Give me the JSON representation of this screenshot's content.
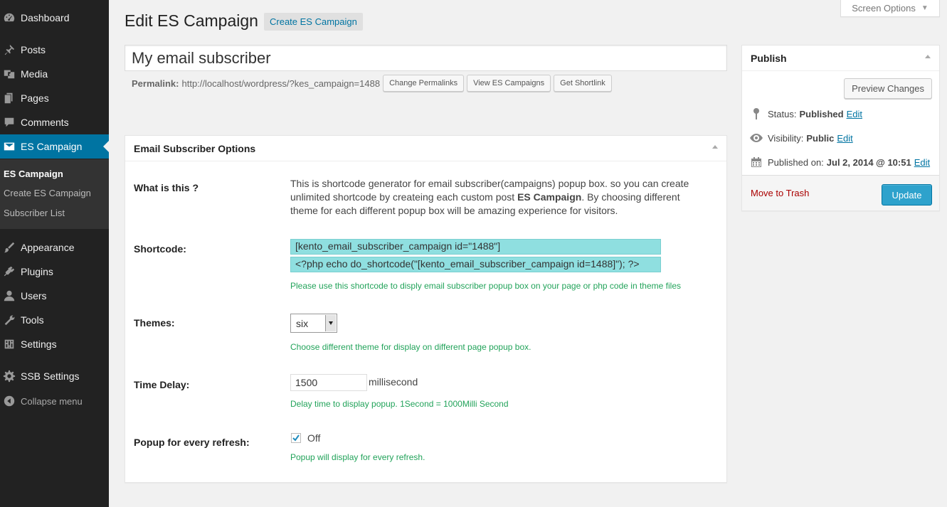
{
  "sidebar": {
    "items": [
      {
        "label": "Dashboard",
        "icon": "dashboard-icon"
      },
      {
        "label": "Posts",
        "icon": "pin-icon"
      },
      {
        "label": "Media",
        "icon": "media-icon"
      },
      {
        "label": "Pages",
        "icon": "pages-icon"
      },
      {
        "label": "Comments",
        "icon": "comment-icon"
      },
      {
        "label": "ES Campaign",
        "icon": "envelope-icon"
      },
      {
        "label": "Appearance",
        "icon": "brush-icon"
      },
      {
        "label": "Plugins",
        "icon": "plugin-icon"
      },
      {
        "label": "Users",
        "icon": "user-icon"
      },
      {
        "label": "Tools",
        "icon": "wrench-icon"
      },
      {
        "label": "Settings",
        "icon": "settings-icon"
      },
      {
        "label": "SSB Settings",
        "icon": "gear-icon"
      }
    ],
    "submenu": [
      "ES Campaign",
      "Create ES Campaign",
      "Subscriber List"
    ],
    "collapse_label": "Collapse menu"
  },
  "screen_options": "Screen Options",
  "page": {
    "title": "Edit ES Campaign",
    "add_new": "Create ES Campaign",
    "post_title": "My email subscriber",
    "permalink_label": "Permalink:",
    "permalink_url": "http://localhost/wordpress/?kes_campaign=1488",
    "buttons": [
      "Change Permalinks",
      "View ES Campaigns",
      "Get Shortlink"
    ]
  },
  "options_box": {
    "title": "Email Subscriber Options",
    "what_label": "What is this ?",
    "what_text_1": "This is shortcode generator for email subscriber(campaigns) popup box. so you can create unlimited shortcode by createing each custom post ",
    "what_text_bold": "ES Campaign",
    "what_text_2": ". By choosing different theme for each different popup box will be amazing experience for visitors.",
    "shortcode_label": "Shortcode:",
    "shortcode_1": "[kento_email_subscriber_campaign id=\"1488\"]",
    "shortcode_2": "<?php echo do_shortcode(\"[kento_email_subscriber_campaign id=1488]\"); ?>",
    "shortcode_hint": "Please use this shortcode to disply email subscriber popup box on your page or php code in theme files",
    "themes_label": "Themes:",
    "themes_value": "six",
    "themes_hint": "Choose different theme for display on different page popup box.",
    "delay_label": "Time Delay:",
    "delay_value": "1500",
    "delay_unit": "millisecond",
    "delay_hint": "Delay time to display popup. 1Second = 1000Milli Second",
    "refresh_label": "Popup for every refresh:",
    "refresh_checked": true,
    "refresh_value": "Off",
    "refresh_hint": "Popup will display for every refresh."
  },
  "publish": {
    "title": "Publish",
    "preview": "Preview Changes",
    "status_label": "Status:",
    "status_value": "Published",
    "visibility_label": "Visibility:",
    "visibility_value": "Public",
    "published_label": "Published on:",
    "published_value": "Jul 2, 2014 @ 10:51",
    "edit": "Edit",
    "trash": "Move to Trash",
    "update": "Update"
  },
  "colors": {
    "sidebar_bg": "#222222",
    "accent": "#0074a2",
    "shortcode_bg": "#8fdfe0",
    "hint": "#22a35a",
    "trash": "#aa0000"
  }
}
